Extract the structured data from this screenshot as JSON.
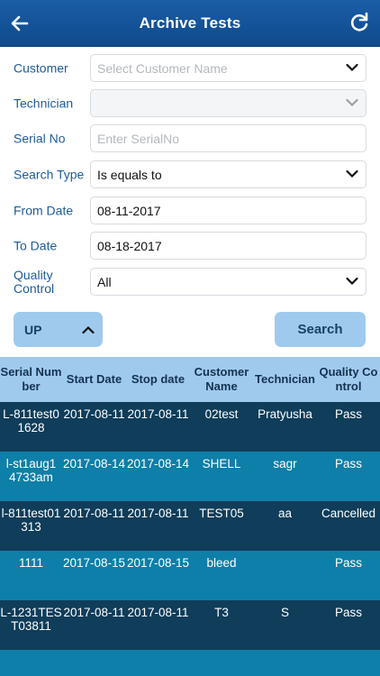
{
  "header": {
    "title": "Archive Tests",
    "back_icon": "back-arrow-icon",
    "refresh_icon": "refresh-icon"
  },
  "form": {
    "customer": {
      "label": "Customer",
      "placeholder": "Select Customer Name"
    },
    "technician": {
      "label": "Technician",
      "value": ""
    },
    "serial_no": {
      "label": "Serial No",
      "placeholder": "Enter SerialNo"
    },
    "search_type": {
      "label": "Search Type",
      "value": "Is equals to"
    },
    "from_date": {
      "label": "From Date",
      "value": "08-11-2017"
    },
    "to_date": {
      "label": "To Date",
      "value": "08-18-2017"
    },
    "quality_control": {
      "label": "Quality Control",
      "value": "All"
    }
  },
  "buttons": {
    "sort_label": "UP",
    "search_label": "Search"
  },
  "table": {
    "columns": [
      "Serial Number",
      "Start Date",
      "Stop date",
      "Customer Name",
      "Technician",
      "Quality Control"
    ],
    "rows": [
      [
        "L-811test01628",
        "2017-08-11",
        "2017-08-11",
        "02test",
        "Pratyusha",
        "Pass"
      ],
      [
        "l-st1aug14733am",
        "2017-08-14",
        "2017-08-14",
        "SHELL",
        "sagr",
        "Pass"
      ],
      [
        "l-811test01313",
        "2017-08-11",
        "2017-08-11",
        "TEST05",
        "aa",
        "Cancelled"
      ],
      [
        "1111",
        "2017-08-15",
        "2017-08-15",
        "bleed",
        "",
        "Pass"
      ],
      [
        "L-1231TEST03811",
        "2017-08-11",
        "2017-08-11",
        "T3",
        "S",
        "Pass"
      ]
    ]
  },
  "colors": {
    "header": "#1a5da6",
    "label": "#1f5b9a",
    "button": "#9fcaee",
    "row_dark": "#0f3d5a",
    "row_light": "#0e7fa8"
  }
}
